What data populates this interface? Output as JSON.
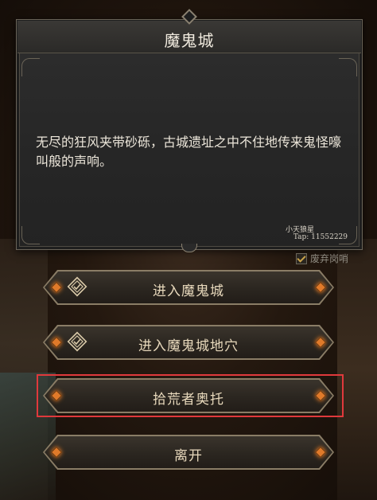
{
  "dialog": {
    "title": "魔鬼城",
    "description": "无尽的狂风夹带砂砾，古城遗址之中不住地传来鬼怪嚎叫般的声响。",
    "signature": "小天狼星",
    "tap_id": "Tap: 11552229"
  },
  "abandon_post": {
    "label": "废弃岗哨",
    "checked": true
  },
  "actions": [
    {
      "label": "进入魔鬼城",
      "icon": "dungeon-icon"
    },
    {
      "label": "进入魔鬼城地穴",
      "icon": "dungeon-icon"
    },
    {
      "label": "拾荒者奥托",
      "highlighted": true
    },
    {
      "label": "离开"
    }
  ],
  "colors": {
    "gem": "#e07a2a",
    "highlight": "#e0393c",
    "button_text": "#e8d9bc"
  }
}
